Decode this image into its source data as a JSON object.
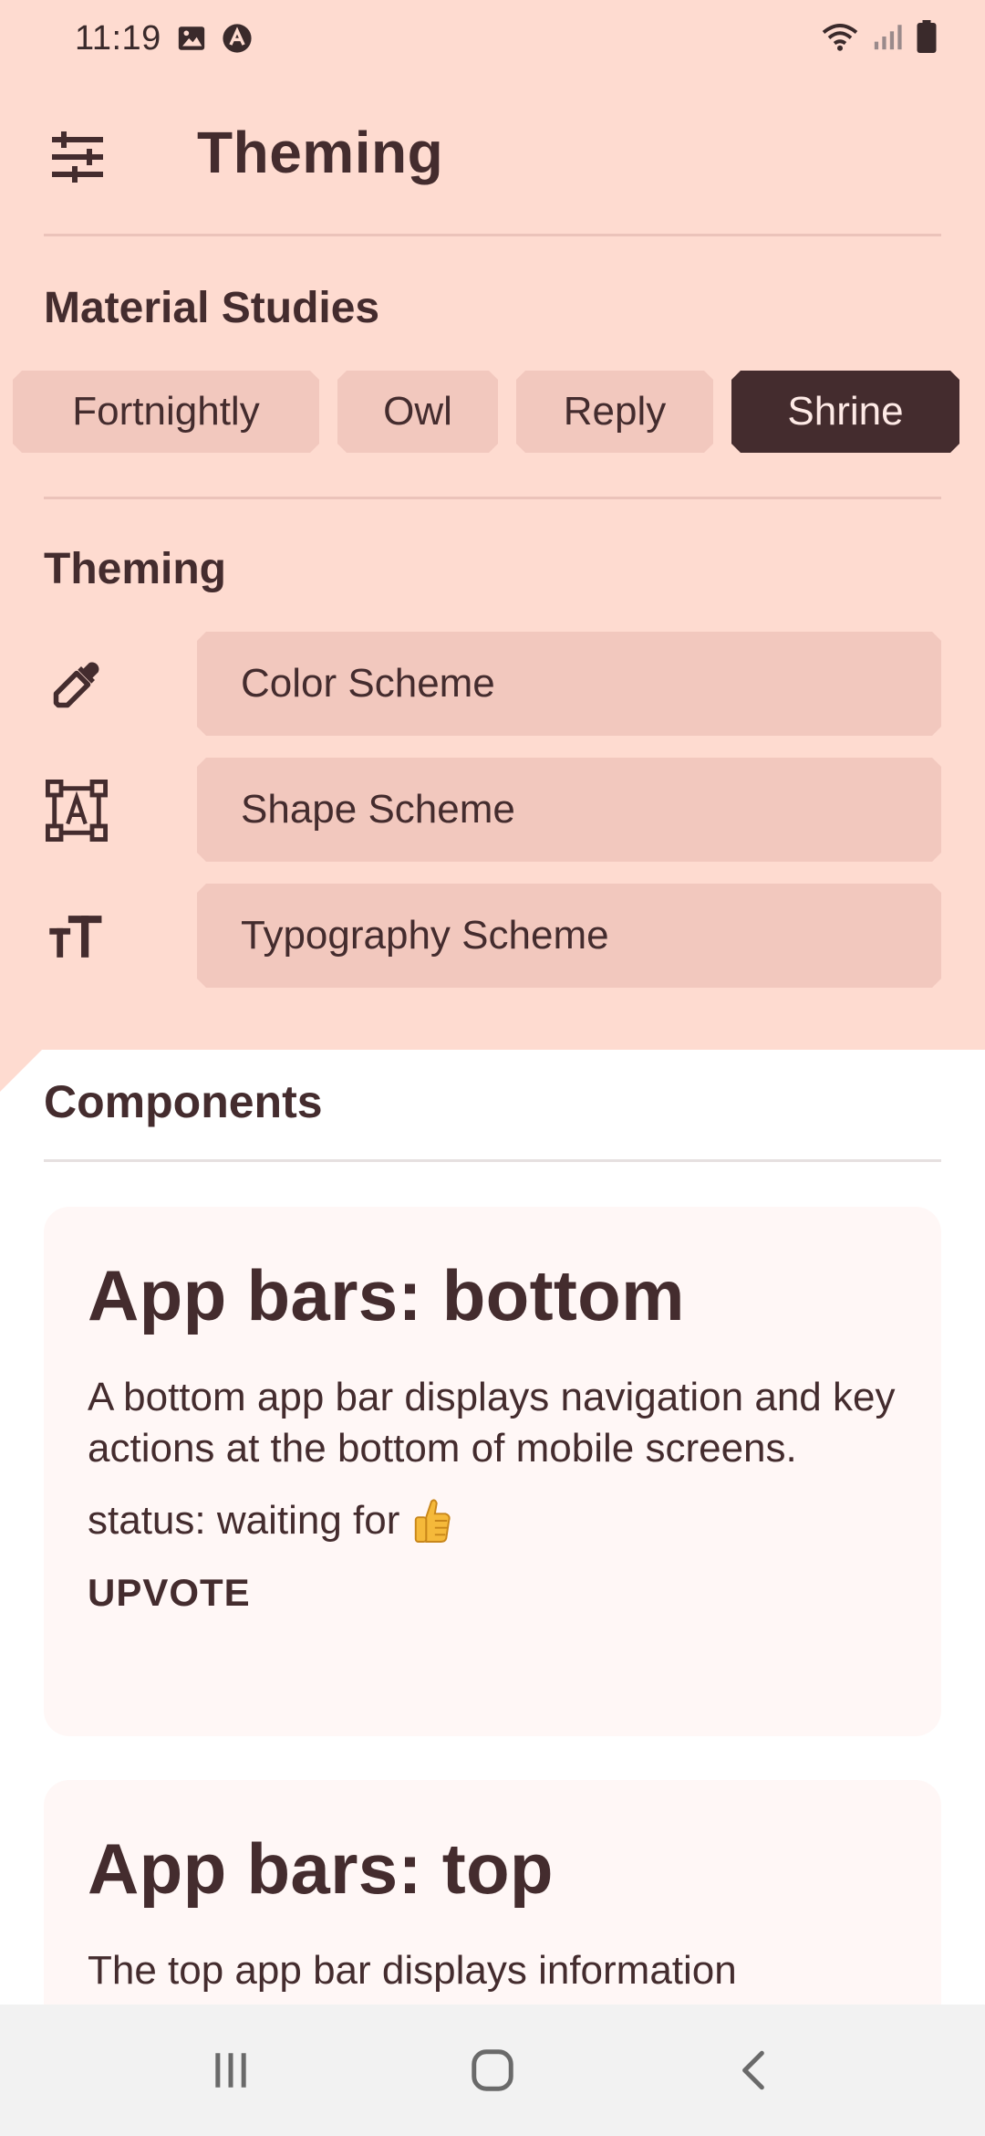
{
  "status_bar": {
    "time": "11:19",
    "left_icons": [
      "gallery-icon",
      "app-notification-icon"
    ],
    "right_icons": [
      "wifi-icon",
      "signal-icon",
      "battery-icon"
    ]
  },
  "top_bar": {
    "menu_icon": "tune-icon",
    "title": "Theming"
  },
  "material_studies": {
    "title": "Material Studies",
    "chips": [
      {
        "label": "Fortnightly",
        "selected": false
      },
      {
        "label": "Owl",
        "selected": false
      },
      {
        "label": "Reply",
        "selected": false
      },
      {
        "label": "Shrine",
        "selected": true
      }
    ]
  },
  "theming": {
    "title": "Theming",
    "items": [
      {
        "icon": "eyedropper-icon",
        "label": "Color Scheme"
      },
      {
        "icon": "shape-icon",
        "label": "Shape Scheme"
      },
      {
        "icon": "text-size-icon",
        "label": "Typography Scheme"
      }
    ]
  },
  "components": {
    "title": "Components",
    "cards": [
      {
        "title": "App bars: bottom",
        "description": "A bottom app bar displays navigation and key actions at the bottom of mobile screens.",
        "status": "status: waiting for",
        "status_icon": "thumbs-up-emoji",
        "action": "UPVOTE"
      },
      {
        "title": "App bars: top",
        "description": "The top app bar displays information"
      }
    ]
  },
  "colors": {
    "backdrop": "#FEDBD0",
    "primary": "#442C2E",
    "chip": "#F2C8BE",
    "surface": "#FFFFFF",
    "card": "#FFF7F6"
  },
  "nav_bar": {
    "buttons": [
      "recents-icon",
      "home-icon",
      "back-icon"
    ]
  }
}
